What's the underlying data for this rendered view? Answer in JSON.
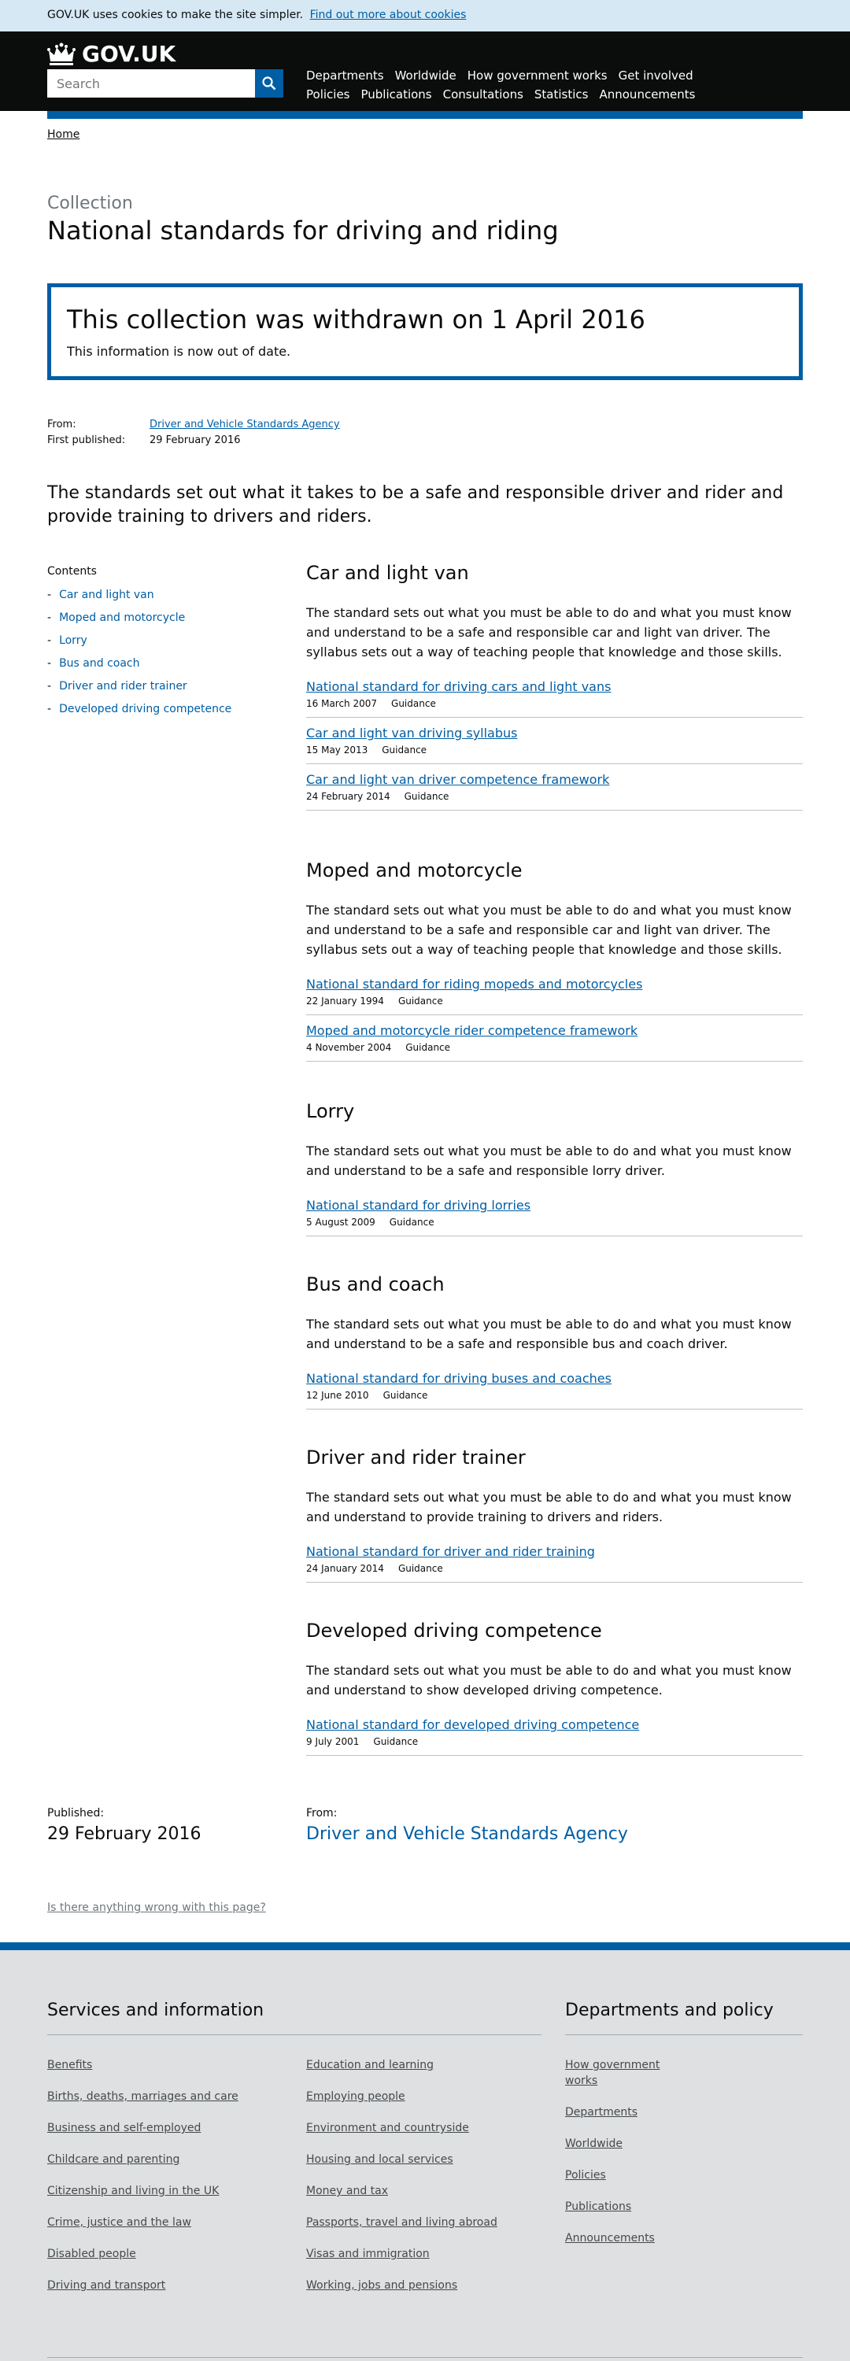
{
  "cookie": {
    "text": "GOV.UK uses cookies to make the site simpler.",
    "link": "Find out more about cookies"
  },
  "header": {
    "logo": "GOV.UK",
    "search_placeholder": "Search",
    "nav": [
      "Departments",
      "Worldwide",
      "How government works",
      "Get involved",
      "Policies",
      "Publications",
      "Consultations",
      "Statistics",
      "Announcements"
    ]
  },
  "breadcrumb": {
    "home": "Home"
  },
  "page": {
    "caption": "Collection",
    "title": "National standards for driving and riding"
  },
  "withdrawn": {
    "heading": "This collection was withdrawn on 1 April 2016",
    "text": "This information is now out of date."
  },
  "meta": {
    "from_label": "From:",
    "from_value": "Driver and Vehicle Standards Agency",
    "published_label": "First published:",
    "published_value": "29 February 2016"
  },
  "summary": "The standards set out what it takes to be a safe and responsible driver and rider and provide training to drivers and riders.",
  "contents": {
    "heading": "Contents",
    "dash": "-",
    "items": [
      "Car and light van",
      "Moped and motorcycle",
      "Lorry",
      "Bus and coach",
      "Driver and rider trainer",
      "Developed driving competence"
    ]
  },
  "sections": [
    {
      "title": "Car and light van",
      "desc": "The standard sets out what you must be able to do and what you must know and understand to be a safe and responsible car and light van driver. The syllabus sets out a way of teaching people that knowledge and those skills.",
      "docs": [
        {
          "title": "National standard for driving cars and light vans",
          "date": "16 March 2007",
          "type": "Guidance"
        },
        {
          "title": "Car and light van driving syllabus",
          "date": "15 May 2013",
          "type": "Guidance"
        },
        {
          "title": "Car and light van driver competence framework",
          "date": "24 February 2014",
          "type": "Guidance"
        }
      ]
    },
    {
      "title": "Moped and motorcycle",
      "desc": "The standard sets out what you must be able to do and what you must know and understand to be a safe and responsible car and light van driver. The syllabus sets out a way of teaching people that knowledge and those skills.",
      "docs": [
        {
          "title": "National standard for riding mopeds and motorcycles",
          "date": "22 January 1994",
          "type": "Guidance"
        },
        {
          "title": "Moped and motorcycle rider competence framework",
          "date": "4 November 2004",
          "type": "Guidance"
        }
      ]
    },
    {
      "title": "Lorry",
      "desc": "The standard sets out what you must be able to do and what you must know and understand to be a safe and responsible lorry driver.",
      "docs": [
        {
          "title": "National standard for driving lorries",
          "date": "5 August 2009",
          "type": "Guidance"
        }
      ]
    },
    {
      "title": "Bus and coach",
      "desc": "The standard sets out what you must be able to do and what you must know and understand to be a safe and responsible bus and coach driver.",
      "docs": [
        {
          "title": "National standard for driving buses and coaches",
          "date": "12 June 2010",
          "type": "Guidance"
        }
      ]
    },
    {
      "title": "Driver and rider trainer",
      "desc": "The standard sets out what you must be able to do and what you must know and understand to provide training to drivers and riders.",
      "docs": [
        {
          "title": "National standard for driver and rider training",
          "date": "24 January 2014",
          "type": "Guidance"
        }
      ]
    },
    {
      "title": "Developed driving competence",
      "desc": "The standard sets out what you must be able to do and what you must know and understand to show developed driving competence.",
      "docs": [
        {
          "title": "National standard for developed driving competence",
          "date": "9 July 2001",
          "type": "Guidance"
        }
      ]
    }
  ],
  "published": {
    "label": "Published:",
    "value": "29 February 2016",
    "from_label": "From:",
    "from_value": "Driver and Vehicle Standards Agency"
  },
  "report_link": "Is there anything wrong with this page?",
  "footer": {
    "services_heading": "Services and information",
    "services_col1": [
      "Benefits",
      "Births, deaths, marriages and care",
      "Business and self-employed",
      "Childcare and parenting",
      "Citizenship and living in the UK",
      "Crime, justice and the law",
      "Disabled people",
      "Driving and transport"
    ],
    "services_col2": [
      "Education and learning",
      "Employing people",
      "Environment and countryside",
      "Housing and local services",
      "Money and tax",
      "Passports, travel and living abroad",
      "Visas and immigration",
      "Working, jobs and pensions"
    ],
    "dept_heading": "Departments and policy",
    "dept_links": [
      "How government works",
      "Departments",
      "Worldwide",
      "Policies",
      "Publications",
      "Announcements"
    ]
  },
  "colors": {
    "brand_blue": "#005ea5",
    "header_black": "#0b0c0c",
    "footer_grey": "#dee0e2"
  },
  "icons": {
    "logo": "crown-icon",
    "search": "search-icon"
  }
}
